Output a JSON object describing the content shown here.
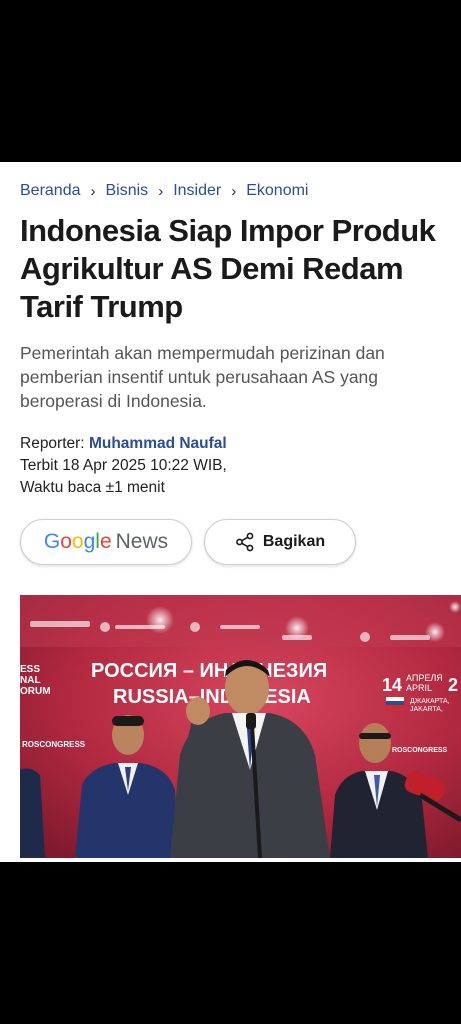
{
  "breadcrumb": {
    "items": [
      "Beranda",
      "Bisnis",
      "Insider",
      "Ekonomi"
    ],
    "separator": "›"
  },
  "article": {
    "title": "Indonesia Siap Impor Produk Agrikultur AS Demi Redam Tarif Trump",
    "subtitle": "Pemerintah akan mempermudah perizinan dan pemberian insentif untuk perusahaan AS yang beroperasi di Indonesia.",
    "reporter_label": "Reporter:",
    "reporter_name": "Muhammad Naufal",
    "published": "Terbit 18 Apr 2025 10:22 WIB,",
    "read_time": "Waktu baca ±1 menit"
  },
  "actions": {
    "google_news_letters": [
      "G",
      "o",
      "o",
      "g",
      "l",
      "e"
    ],
    "google_news_suffix": "News",
    "share_label": "Bagikan"
  },
  "photo": {
    "banner_line1": "РОССИЯ – ИНДОНЕЗИЯ",
    "banner_line2": "RUSSIA–INDONESIA",
    "date_day": "14",
    "date_ru": "АПРЕЛЯ",
    "date_en": "APRIL",
    "date_partial": "2",
    "city_ru": "ДЖАКАРТА,",
    "city_en": "JAKARTA,",
    "side_text": [
      "ESS",
      "NAL",
      "ORUM"
    ],
    "roscongress_left": "ROSCONGRESS",
    "roscongress_right": "ROSCONGRESS"
  },
  "colors": {
    "link_blue": "#2a4d9a",
    "google_blue": "#4285F4",
    "google_red": "#EA4335",
    "google_yellow": "#FBBC05",
    "google_green": "#34A853",
    "banner_red": "#b0283f"
  }
}
